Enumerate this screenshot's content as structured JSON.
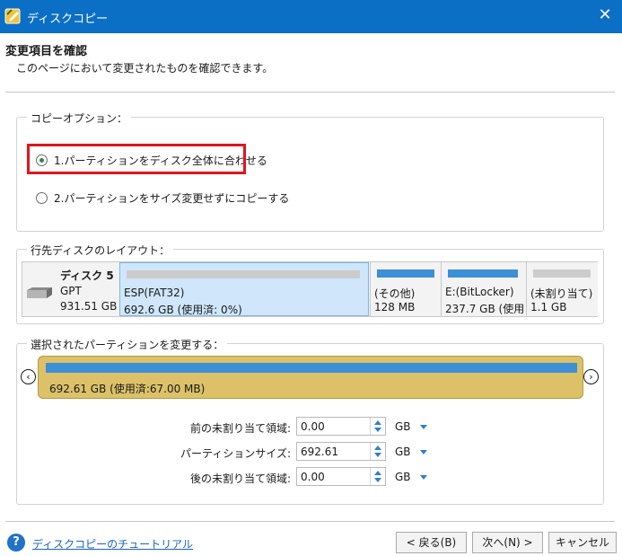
{
  "window": {
    "title": "ディスクコピー",
    "close_glyph": "✕"
  },
  "header": {
    "title": "変更項目を確認",
    "subtitle": "このページにおいて変更されたものを確認できます。"
  },
  "copy_options": {
    "label": "コピーオプション：",
    "option1": "1.パーティションをディスク全体に合わせる",
    "option2": "2.パーティションをサイズ変更せずにコピーする",
    "selected": 1
  },
  "layout": {
    "label": "行先ディスクのレイアウト：",
    "disk": {
      "name": "ディスク 5",
      "type": "GPT",
      "size": "931.51 GB"
    },
    "partitions": [
      {
        "name": "ESP(FAT32)",
        "size": "692.6 GB (使用済: 0%)",
        "bar_color": "#cccccc"
      },
      {
        "name": "(その他)",
        "size": "128 MB",
        "bar_color": "#3d8fd8"
      },
      {
        "name": "E:(BitLocker)",
        "size": "237.7 GB (使用",
        "bar_color": "#3d8fd8"
      },
      {
        "name": "(未割り当て)",
        "size": "1.1 GB",
        "bar_color": "#cccccc"
      }
    ]
  },
  "change": {
    "label": "選択されたパーティションを変更する：",
    "block_text": "692.61 GB (使用済:67.00 MB)",
    "nav_prev": "‹",
    "nav_next": "›",
    "fields": [
      {
        "label": "前の未割り当て領域:",
        "value": "0.00",
        "unit": "GB"
      },
      {
        "label": "パーティションサイズ:",
        "value": "692.61",
        "unit": "GB"
      },
      {
        "label": "後の未割り当て領域:",
        "value": "0.00",
        "unit": "GB"
      }
    ]
  },
  "footer": {
    "help_glyph": "?",
    "help_link": "ディスクコピーのチュートリアル",
    "back": "< 戻る(B)",
    "next": "次へ(N) >",
    "cancel": "キャンセル"
  },
  "colors": {
    "titlebar": "#0b6fc6",
    "highlight": "#e0141b",
    "partition_block": "#dcc168",
    "accent_blue": "#3d8fd8"
  }
}
